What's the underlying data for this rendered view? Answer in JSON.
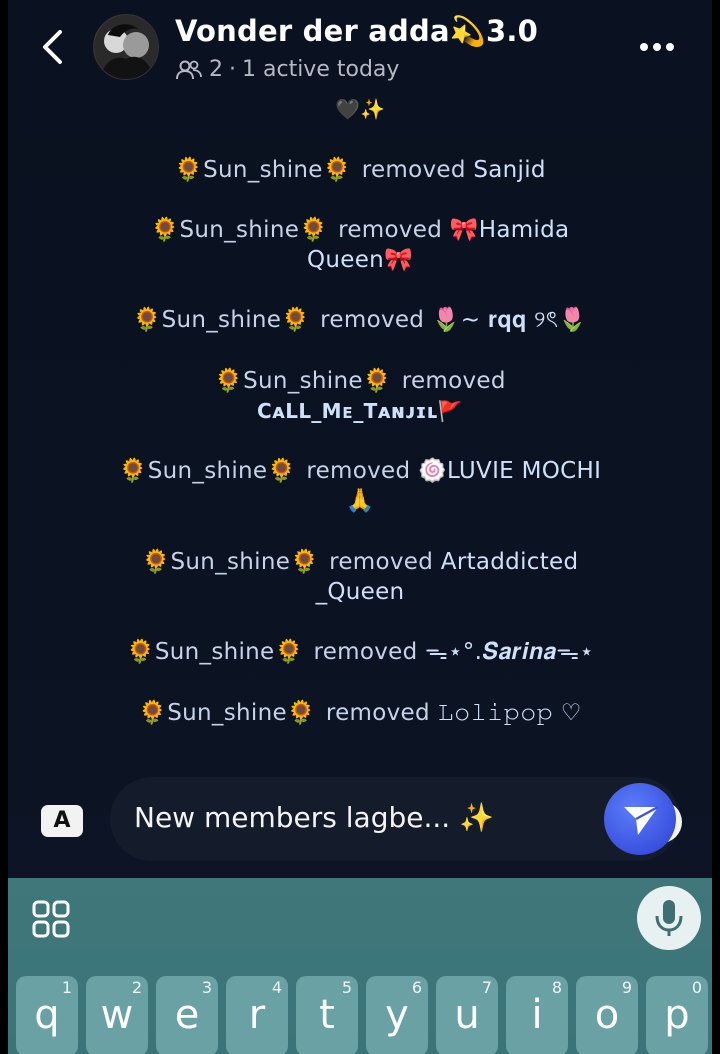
{
  "header": {
    "title": "Vonder der adda💫3.0",
    "members_count": "2",
    "separator": "·",
    "active_status": "1 active today"
  },
  "chat": {
    "top_emojis": "🖤✨",
    "events": [
      {
        "user": "🌻Sun_shine🌻",
        "verb": "removed",
        "target": "Sanjid"
      },
      {
        "user": "🌻Sun_shine🌻",
        "verb": "removed",
        "target": "🎀Hamida",
        "target_line2": "Queen🎀"
      },
      {
        "user": "🌻Sun_shine🌻",
        "verb": "removed",
        "target": "🌷~ 𝐫𝐪𝐪 ୨ৎ🌷"
      },
      {
        "user": "🌻Sun_shine🌻",
        "verb": "removed",
        "target": "",
        "target_line2": "CᴀLL_Mᴇ_Tᴀɴᴊɪʟ🚩"
      },
      {
        "user": "🌻Sun_shine🌻",
        "verb": "removed",
        "target": "🍥LUVIE MOCHI",
        "target_line2": "🙏"
      },
      {
        "user": "🌻Sun_shine🌻",
        "verb": "removed",
        "target": "Artaddicted",
        "target_line2": "_Queen"
      },
      {
        "user": "🌻Sun_shine🌻",
        "verb": "removed",
        "target": "ᯓ⋆°.𝑺𝒂𝒓𝒊𝒏𝒂ᯓ⋆"
      },
      {
        "user": "🌻Sun_shine🌻",
        "verb": "removed",
        "target": "𝙻𝚘𝚕𝚒𝚙𝚘𝚙 ♡"
      }
    ]
  },
  "composer": {
    "mode_label": "A",
    "message_text": "New members lagbe... ✨"
  },
  "keyboard": {
    "row1": [
      {
        "letter": "q",
        "num": "1"
      },
      {
        "letter": "w",
        "num": "2"
      },
      {
        "letter": "e",
        "num": "3"
      },
      {
        "letter": "r",
        "num": "4"
      },
      {
        "letter": "t",
        "num": "5"
      },
      {
        "letter": "y",
        "num": "6"
      },
      {
        "letter": "u",
        "num": "7"
      },
      {
        "letter": "i",
        "num": "8"
      },
      {
        "letter": "o",
        "num": "9"
      },
      {
        "letter": "p",
        "num": "0"
      }
    ]
  },
  "icons": {
    "back": "chevron-left-icon",
    "more": "more-horizontal-icon",
    "members": "people-icon",
    "emoji": "emoji-icon",
    "send": "send-icon",
    "apps": "grid-icon",
    "mic": "microphone-icon"
  },
  "colors": {
    "background": "#0b1322",
    "send_button": "#3b52e0",
    "keyboard": "#3f777b",
    "key": "#6aa1a5"
  }
}
